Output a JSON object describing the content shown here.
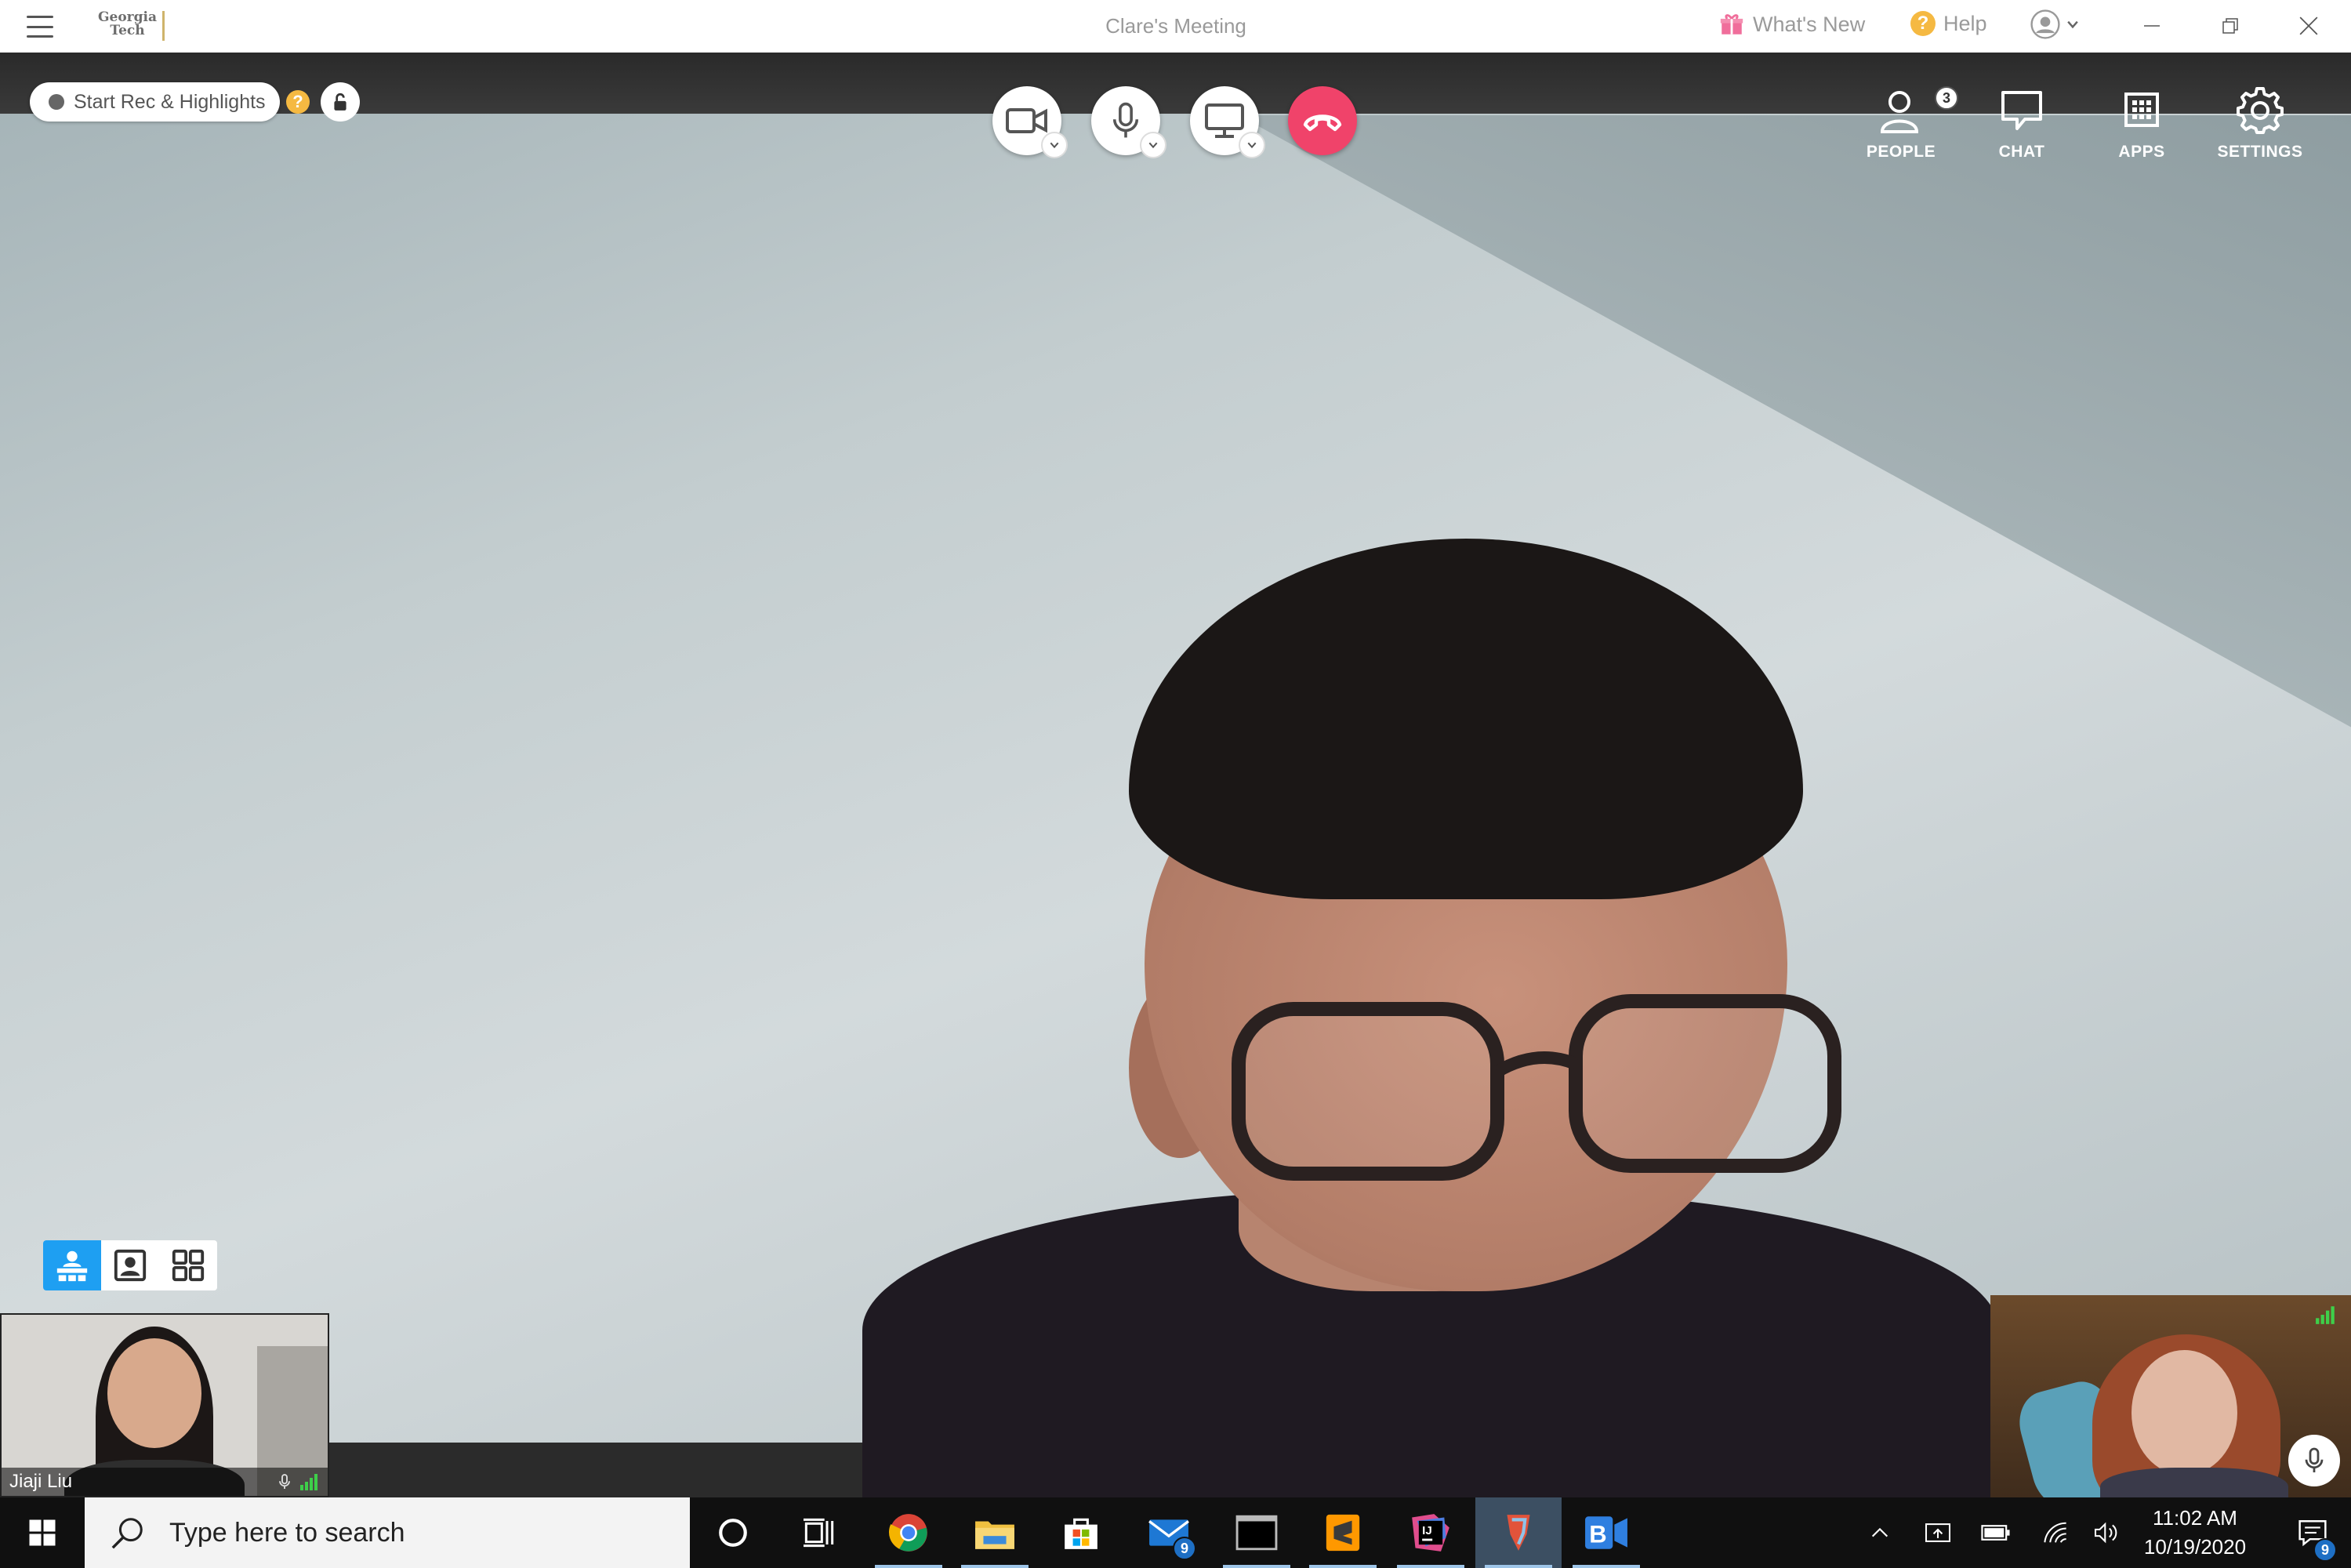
{
  "titlebar": {
    "logo_line1": "Georgia",
    "logo_line2": "Tech",
    "meeting_title": "Clare's Meeting",
    "whats_new": "What's New",
    "help": "Help"
  },
  "recording": {
    "label": "Start Rec & Highlights",
    "help_glyph": "?"
  },
  "call_controls": [
    "camera-icon",
    "microphone-icon",
    "screen-share-icon",
    "hang-up-icon"
  ],
  "toolbar": {
    "people_label": "PEOPLE",
    "people_count": "3",
    "chat_label": "CHAT",
    "apps_label": "APPS",
    "settings_label": "SETTINGS"
  },
  "participants": {
    "tile_1_name": "Jiaji Liu"
  },
  "taskbar": {
    "search_placeholder": "Type here to search",
    "mail_badge": "9",
    "notification_badge": "9",
    "time": "11:02 AM",
    "date": "10/19/2020",
    "apps": [
      "cortana-icon",
      "task-view-icon",
      "chrome-icon",
      "file-explorer-icon",
      "microsoft-store-icon",
      "mail-icon",
      "terminal-icon",
      "sublime-text-icon",
      "intellij-icon",
      "bluejeans-active-icon",
      "bluejeans-icon"
    ]
  },
  "colors": {
    "hangup": "#f0436a",
    "accent_blue": "#1e9ff2",
    "taskbar": "#101010",
    "signal_green": "#3ecf4a",
    "help_yellow": "#f5b942"
  }
}
